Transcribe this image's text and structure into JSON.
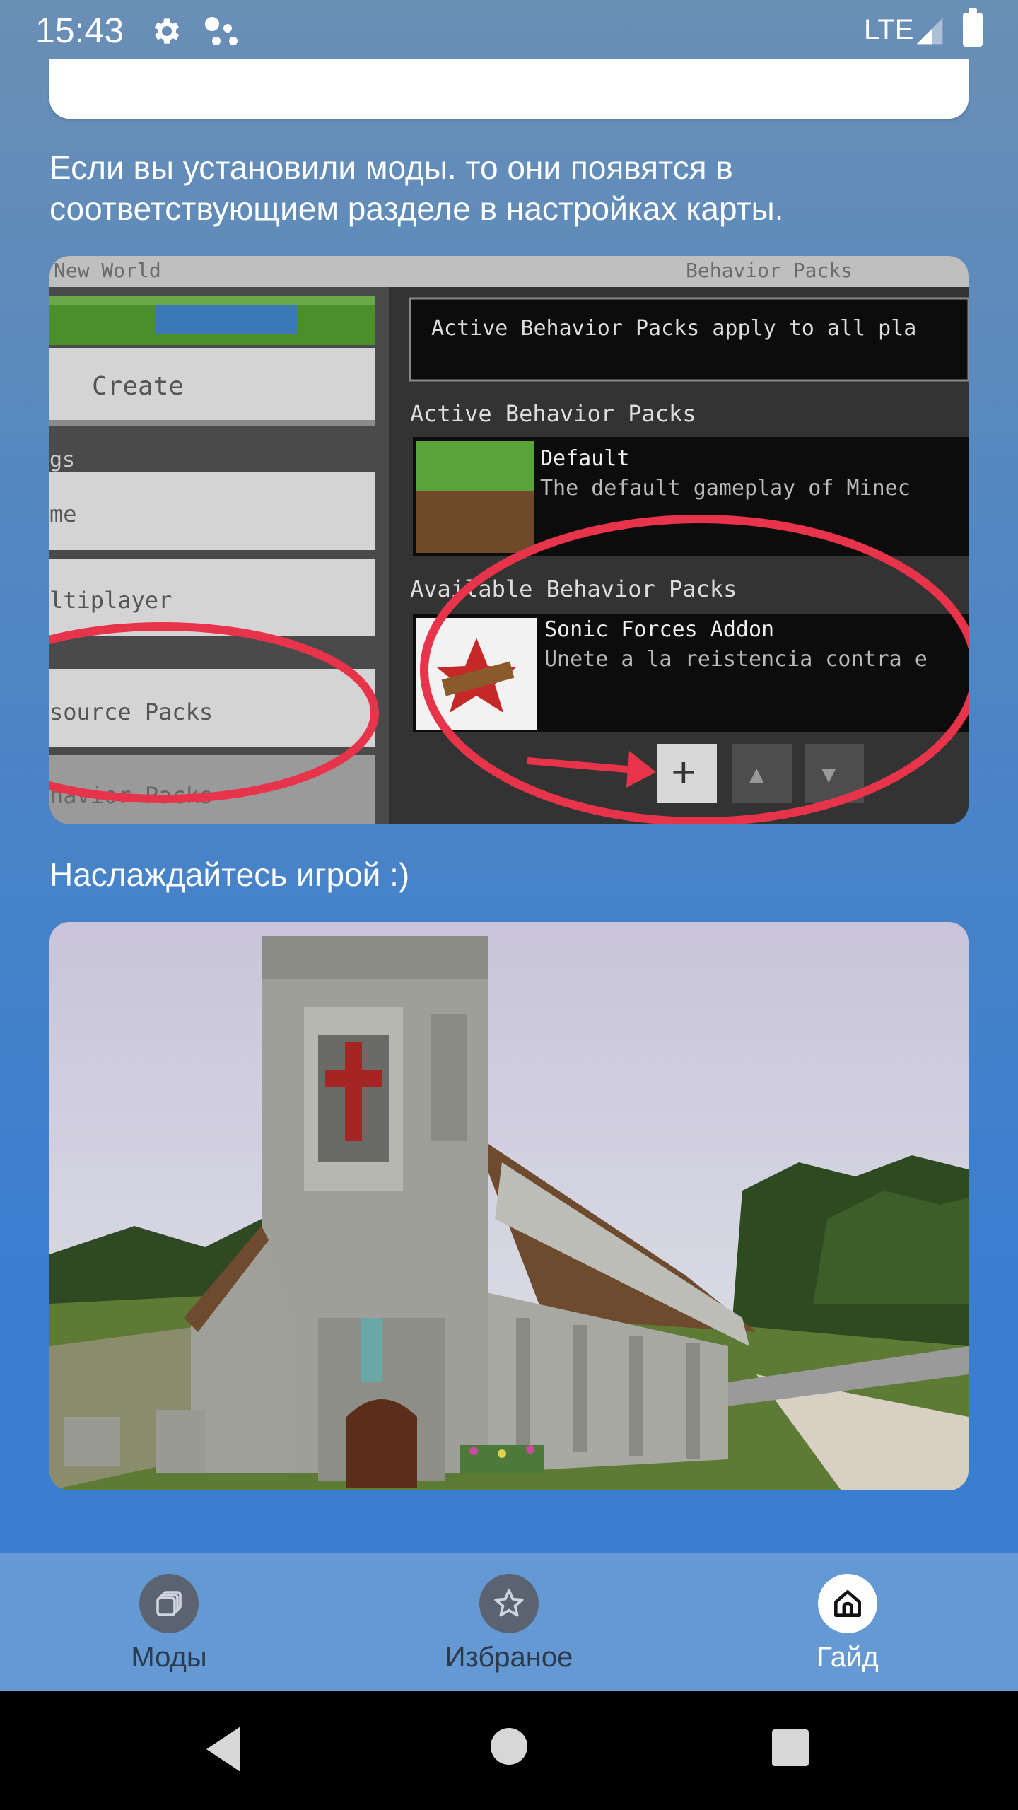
{
  "status_bar": {
    "time": "15:43",
    "network": "LTE",
    "icons": [
      "gear-icon",
      "assistant-dots-icon",
      "signal-icon",
      "battery-icon"
    ]
  },
  "guide": {
    "paragraph_mods": "Если вы установили моды. то они появятся в соответствующием разделе в настройках карты.",
    "paragraph_enjoy": "Наслаждайтесь игрой :)",
    "screenshot_settings": {
      "texts": {
        "new_world": "New World",
        "behavior_packs_header": "Behavior Packs",
        "active_info": "Active Behavior Packs apply to all pla",
        "create": "Create",
        "gs": "gs",
        "game": "me",
        "multiplayer": "ltiplayer",
        "active_packs": "Active Behavior Packs",
        "default_title": "Default",
        "default_desc": "The default gameplay of Minec",
        "available_packs": "Available Behavior Packs",
        "sonic_title": "Sonic Forces Addon",
        "sonic_desc": "Unete a la reistencia contra e",
        "resource_packs": "source Packs",
        "behavior_packs": "havior Packs",
        "plus": "+",
        "up": "▲",
        "down": "▼"
      }
    }
  },
  "bottom_nav": {
    "items": [
      {
        "label": "Моды",
        "icon": "layers-icon",
        "active": false
      },
      {
        "label": "Избраное",
        "icon": "star-icon",
        "active": false
      },
      {
        "label": "Гайд",
        "icon": "home-icon",
        "active": true
      }
    ]
  },
  "colors": {
    "nav_bar": "#6499d4",
    "accent_red": "#e8344a"
  }
}
